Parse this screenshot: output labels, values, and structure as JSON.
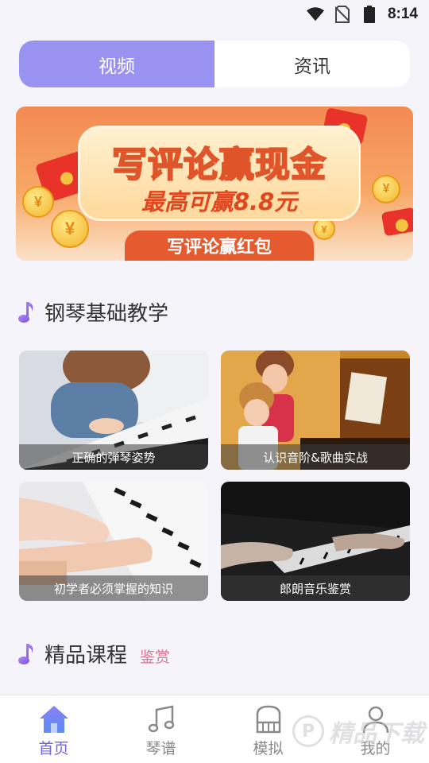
{
  "status_bar": {
    "time": "8:14",
    "icons": [
      "wifi-icon",
      "no-sim-icon",
      "battery-icon"
    ]
  },
  "tabs": {
    "active": "视频",
    "inactive": "资讯"
  },
  "banner": {
    "headline": "写评论赢现金",
    "subline": "最高可赢8.8元",
    "button": "写评论赢红包"
  },
  "section1": {
    "title": "钢琴基础教学"
  },
  "cards": [
    {
      "caption": "正确的弹琴姿势"
    },
    {
      "caption": "认识音阶&歌曲实战"
    },
    {
      "caption": "初学者必须掌握的知识"
    },
    {
      "caption": "郎朗音乐鉴赏"
    }
  ],
  "section2": {
    "title": "精品课程",
    "tag": "鉴赏"
  },
  "nav": [
    {
      "label": "首页",
      "icon": "home-icon",
      "active": true
    },
    {
      "label": "琴谱",
      "icon": "music-note-icon",
      "active": false
    },
    {
      "label": "模拟",
      "icon": "piano-icon",
      "active": false
    },
    {
      "label": "我的",
      "icon": "user-icon",
      "active": false
    }
  ],
  "watermark": "精品下载",
  "colors": {
    "accent": "#9a92f0",
    "nav_active": "#6f63e6",
    "tag": "#e0708d"
  }
}
